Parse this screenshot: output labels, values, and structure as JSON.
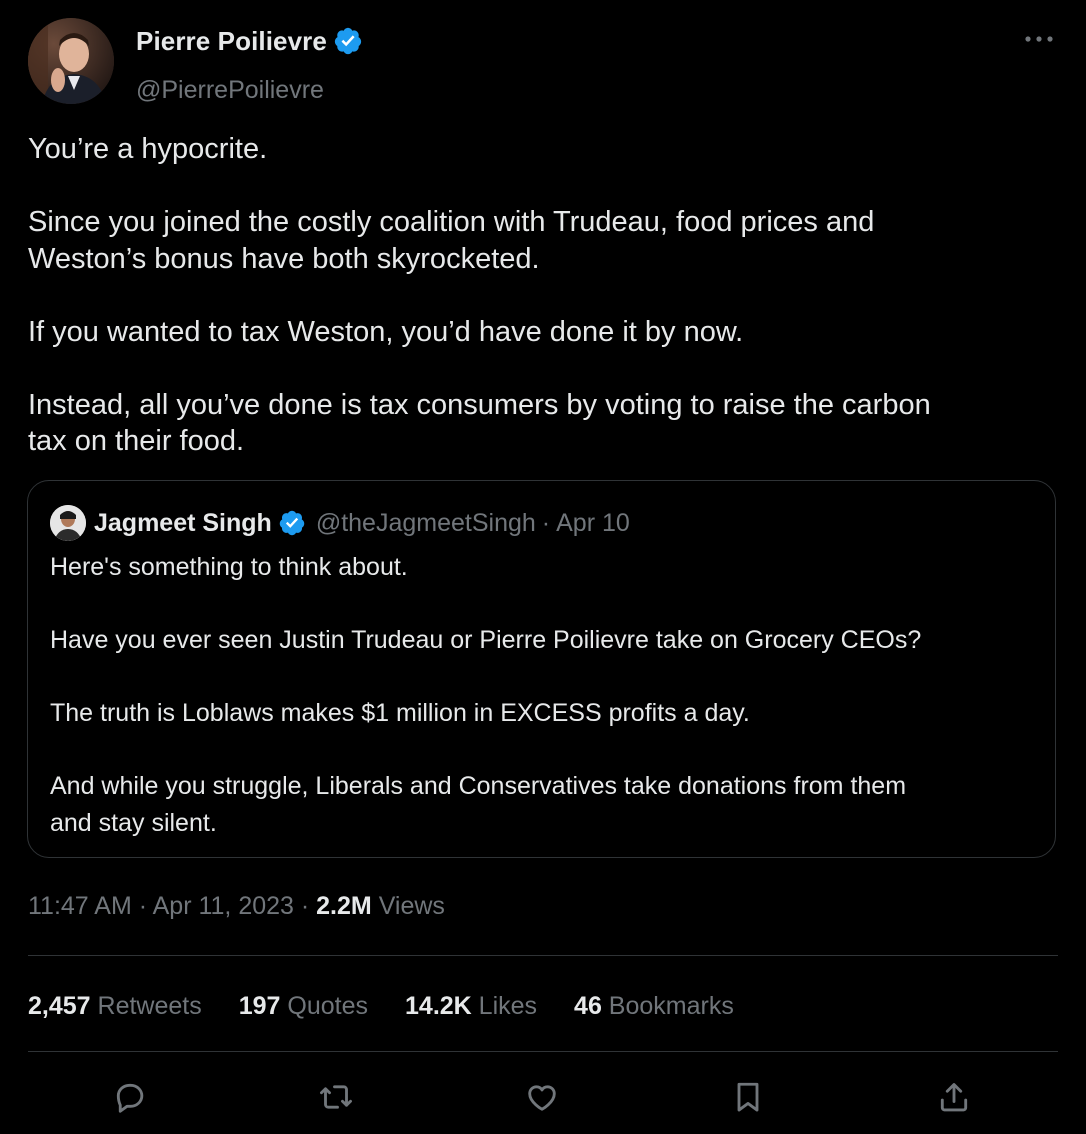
{
  "author": {
    "display_name": "Pierre Poilievre",
    "handle": "@PierrePoilievre",
    "verified_icon": "verified-badge-icon"
  },
  "tweet": {
    "paragraphs": [
      [
        "You’re a hypocrite."
      ],
      [
        "Since you joined the costly coalition with Trudeau, food prices and",
        "Weston’s bonus have both skyrocketed."
      ],
      [
        "If you wanted to tax Weston, you’d have done it by now."
      ],
      [
        "Instead, all you’ve done is tax consumers by voting to raise the carbon",
        "tax on their food."
      ]
    ]
  },
  "quote": {
    "display_name": "Jagmeet Singh",
    "handle": "@theJagmeetSingh",
    "separator": "·",
    "date": "Apr 10",
    "paragraphs": [
      [
        "Here's something to think about."
      ],
      [
        "Have you ever seen Justin Trudeau or Pierre Poilievre take on Grocery CEOs?"
      ],
      [
        "The truth is Loblaws makes $1 million in EXCESS profits a day."
      ],
      [
        "And while you struggle, Liberals and Conservatives take donations from them",
        "and stay silent."
      ]
    ]
  },
  "meta": {
    "time": "11:47 AM",
    "separator1": " · ",
    "date": "Apr 11, 2023",
    "separator2": " · ",
    "views_count": "2.2M",
    "views_label": " Views"
  },
  "stats": {
    "retweets": {
      "count": "2,457",
      "label": " Retweets"
    },
    "quotes": {
      "count": "197",
      "label": " Quotes"
    },
    "likes": {
      "count": "14.2K",
      "label": " Likes"
    },
    "bookmarks": {
      "count": "46",
      "label": " Bookmarks"
    }
  },
  "actions": [
    "reply-icon",
    "retweet-icon",
    "like-icon",
    "bookmark-icon",
    "share-icon"
  ],
  "colors": {
    "background": "#000000",
    "primary_text": "#e7e9ea",
    "secondary_text": "#71767b",
    "border": "#2f3336",
    "verified": "#1d9bf0"
  }
}
